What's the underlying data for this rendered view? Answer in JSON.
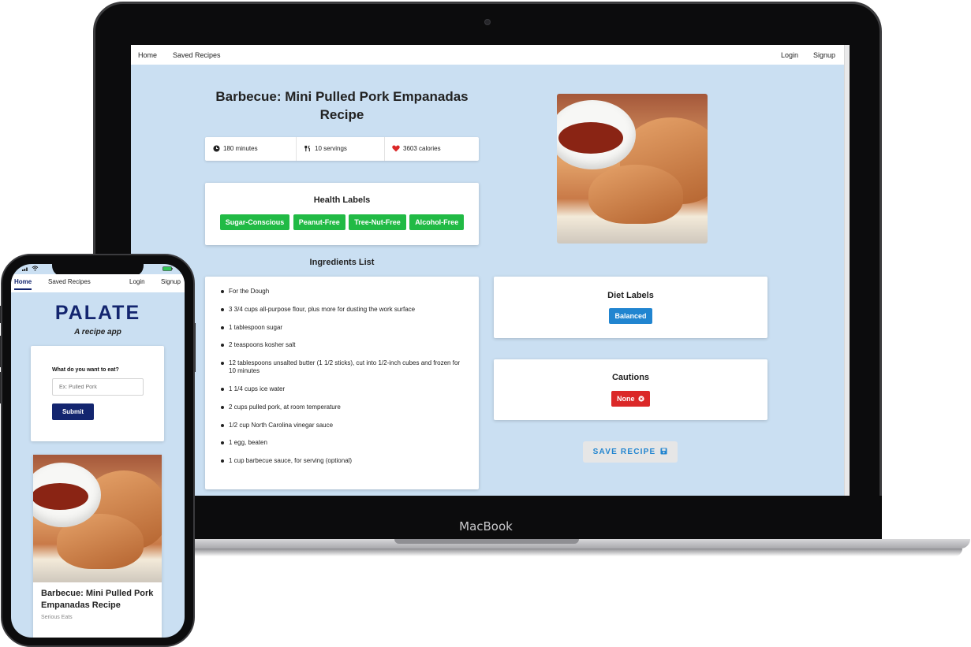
{
  "laptop": {
    "brand": "MacBook",
    "nav": {
      "home": "Home",
      "saved": "Saved Recipes",
      "login": "Login",
      "signup": "Signup"
    },
    "recipe": {
      "title": "Barbecue: Mini Pulled Pork Empanadas Recipe",
      "stats": {
        "time": "180 minutes",
        "servings": "10 servings",
        "calories": "3603 calories"
      },
      "health_title": "Health Labels",
      "health_labels": [
        "Sugar-Conscious",
        "Peanut-Free",
        "Tree-Nut-Free",
        "Alcohol-Free"
      ],
      "ingredients_title": "Ingredients List",
      "ingredients": [
        "For the Dough",
        "3 3/4 cups all-purpose flour, plus more for dusting the work surface",
        "1 tablespoon sugar",
        "2 teaspoons kosher salt",
        "12 tablespoons unsalted butter (1 1/2 sticks), cut into 1/2-inch cubes and frozen for 10 minutes",
        "1 1/4 cups ice water",
        "2 cups pulled pork, at room temperature",
        "1/2 cup North Carolina vinegar sauce",
        "1 egg, beaten",
        "1 cup barbecue sauce, for serving (optional)"
      ],
      "diet_title": "Diet Labels",
      "diet_labels": [
        "Balanced"
      ],
      "cautions_title": "Cautions",
      "cautions": [
        "None"
      ],
      "save_label": "SAVE RECIPE"
    }
  },
  "phone": {
    "nav": {
      "home": "Home",
      "saved": "Saved Recipes",
      "login": "Login",
      "signup": "Signup"
    },
    "app_title": "PALATE",
    "app_subtitle": "A recipe app",
    "search": {
      "label": "What do you want to eat?",
      "placeholder": "Ex: Pulled Pork",
      "submit": "Submit"
    },
    "card": {
      "title": "Barbecue: Mini Pulled Pork Empanadas Recipe",
      "source": "Serious Eats"
    }
  },
  "colors": {
    "page_bg": "#cadff2",
    "green": "#21ba45",
    "blue": "#2185d0",
    "red": "#db2828",
    "navy": "#13256f"
  },
  "icons": [
    "clock-icon",
    "utensils-icon",
    "heart-icon",
    "save-icon",
    "circle-x-icon",
    "wifi-icon",
    "battery-icon",
    "signal-icon"
  ]
}
